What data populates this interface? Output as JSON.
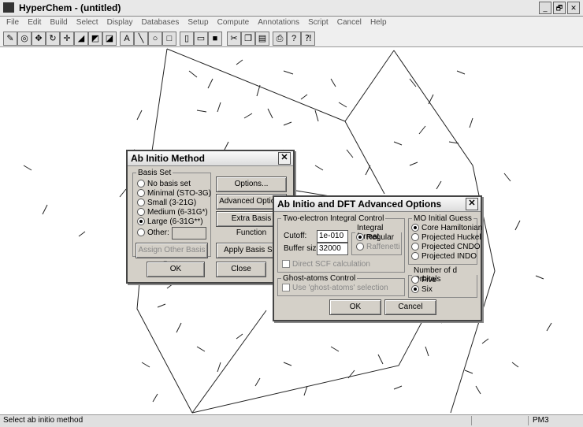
{
  "app": {
    "title": "HyperChem - (untitled)",
    "window_buttons": [
      "_",
      "🗗",
      "✕"
    ]
  },
  "menu": [
    "File",
    "Edit",
    "Build",
    "Select",
    "Display",
    "Databases",
    "Setup",
    "Compute",
    "Annotations",
    "Script",
    "Cancel",
    "Help"
  ],
  "toolbar_icons": [
    "draw-icon",
    "select-icon",
    "rotate-xy-icon",
    "rotate-z-icon",
    "translate-icon",
    "scale-icon",
    "clip-icon",
    "text-a-icon",
    "line-icon",
    "ellipse-icon",
    "rectangle-icon",
    "new-icon",
    "open-icon",
    "save-icon",
    "cut-icon",
    "copy-icon",
    "paste-icon",
    "print-icon",
    "help-icon",
    "context-help-icon"
  ],
  "status": {
    "message": "Select ab initio method",
    "method": "PM3"
  },
  "ab_initio": {
    "title": "Ab Initio Method",
    "basis_set_legend": "Basis Set",
    "basis_options": [
      {
        "label": "No basis set",
        "selected": false
      },
      {
        "label": "Minimal (STO-3G)",
        "selected": false
      },
      {
        "label": "Small (3-21G)",
        "selected": false
      },
      {
        "label": "Medium (6-31G*)",
        "selected": false
      },
      {
        "label": "Large (6-31G**)",
        "selected": true
      },
      {
        "label": "Other:",
        "selected": false
      }
    ],
    "buttons": {
      "options": "Options...",
      "advanced": "Advanced Options",
      "extra_basis": "Extra Basis Function",
      "assign_other": "Assign Other Basis Set...",
      "apply_basis": "Apply Basis Set",
      "ok": "OK",
      "close": "Close"
    }
  },
  "advanced": {
    "title": "Ab Initio and DFT Advanced Options",
    "two_electron_legend": "Two-electron Integral Control",
    "cutoff_label": "Cutoff:",
    "cutoff_value": "1e-010",
    "buffer_label": "Buffer size:",
    "buffer_value": "32000",
    "integral_format_legend": "Integral format",
    "integral_formats": [
      {
        "label": "Regular",
        "selected": true
      },
      {
        "label": "Raffenetti",
        "selected": false
      }
    ],
    "direct_scf": "Direct SCF calculation",
    "ghost_legend": "Ghost-atoms Control",
    "ghost_option": "Use 'ghost-atoms' selection",
    "mo_guess_legend": "MO Initial Guess",
    "mo_guess_options": [
      {
        "label": "Core Hamiltonian",
        "selected": true
      },
      {
        "label": "Projected Huckel",
        "selected": false
      },
      {
        "label": "Projected CNDO",
        "selected": false
      },
      {
        "label": "Projected INDO",
        "selected": false
      }
    ],
    "d_orbitals_legend": "Number of d Orbitals",
    "d_orbital_options": [
      {
        "label": "Five",
        "selected": false
      },
      {
        "label": "Six",
        "selected": true
      }
    ],
    "ok": "OK",
    "cancel": "Cancel"
  }
}
